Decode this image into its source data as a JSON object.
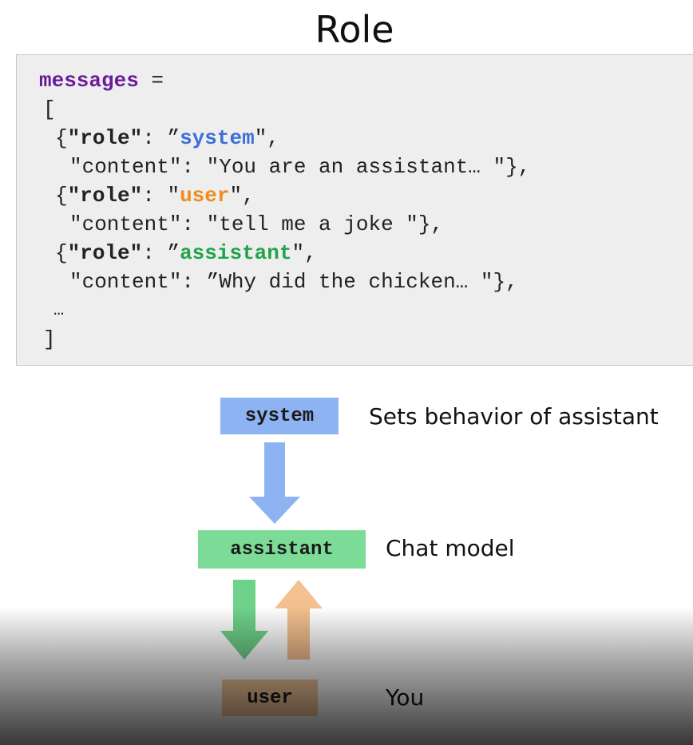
{
  "title": "Role",
  "code": {
    "var": "messages",
    "assign": " =",
    "open_bracket": "[",
    "l1_open": "{",
    "l1_key": "\"role\"",
    "l1_colon": ": ",
    "l1_q1": "”",
    "l1_val": "system",
    "l1_q2": "\",",
    "l2": "\"content\": \"You are an assistant… \"},",
    "l3_open": "{",
    "l3_key": "\"role\"",
    "l3_colon": ": ",
    "l3_q1": "\"",
    "l3_val": "user",
    "l3_q2": "\",",
    "l4": "\"content\": \"tell me a joke \"},",
    "l5_open": "{",
    "l5_key": "\"role\"",
    "l5_colon": ": ",
    "l5_q1": "”",
    "l5_val": "assistant",
    "l5_q2": "\",",
    "l6": "\"content\": ”Why did the chicken… \"},",
    "ellipsis": "…",
    "close_bracket": "]"
  },
  "diagram": {
    "system_label": "system",
    "system_desc": "Sets behavior of assistant",
    "assistant_label": "assistant",
    "assistant_desc": "Chat model",
    "user_label": "user",
    "user_desc": "You"
  },
  "colors": {
    "system_box": "#8eb3f2",
    "assistant_box": "#7ddb98",
    "user_box": "#f5c89a",
    "arrow_blue": "#8eb3f2",
    "arrow_green": "#6fd28a",
    "arrow_orange": "#f3c08f"
  }
}
